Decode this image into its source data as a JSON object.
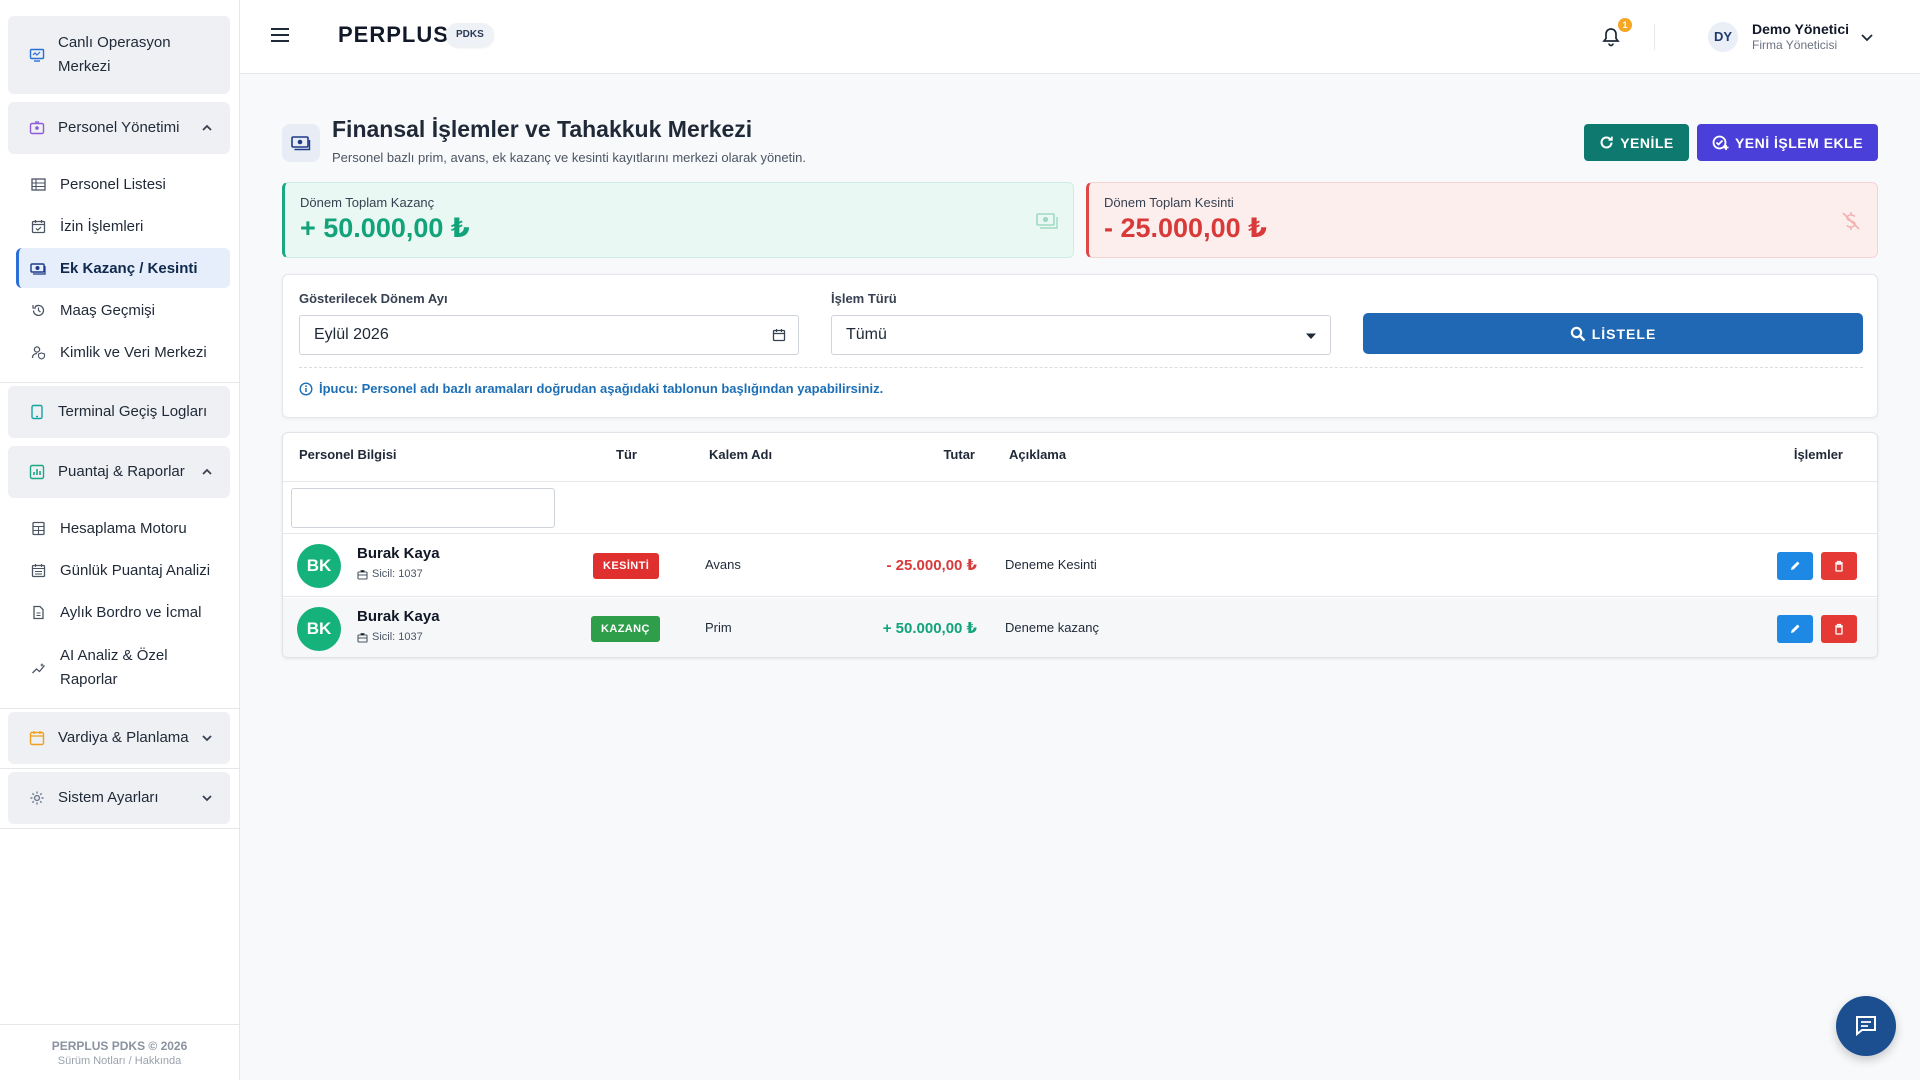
{
  "sidebar": {
    "groups": [
      {
        "label": "Canlı Operasyon Merkezi",
        "icon": "monitor-icon"
      },
      {
        "label": "Personel Yönetimi",
        "icon": "id-card-icon",
        "expanded": true
      },
      {
        "label": "Terminal Geçiş Logları",
        "icon": "tablet-icon"
      },
      {
        "label": "Puantaj & Raporlar",
        "icon": "chart-icon",
        "expanded": true
      },
      {
        "label": "Vardiya & Planlama",
        "icon": "calendar-icon",
        "expanded": false
      },
      {
        "label": "Sistem Ayarları",
        "icon": "gear-icon",
        "expanded": false
      }
    ],
    "personel_items": [
      {
        "label": "Personel Listesi",
        "icon": "table-icon"
      },
      {
        "label": "İzin İşlemleri",
        "icon": "calendar-check-icon"
      },
      {
        "label": "Ek Kazanç / Kesinti",
        "icon": "money-icon",
        "active": true
      },
      {
        "label": "Maaş Geçmişi",
        "icon": "history-icon"
      },
      {
        "label": "Kimlik ve Veri Merkezi",
        "icon": "user-shield-icon"
      }
    ],
    "puantaj_items": [
      {
        "label": "Hesaplama Motoru",
        "icon": "calculator-icon"
      },
      {
        "label": "Günlük Puantaj Analizi",
        "icon": "calendar-grid-icon"
      },
      {
        "label": "Aylık Bordro ve İcmal",
        "icon": "document-icon"
      },
      {
        "label": "AI Analiz & Özel Raporlar",
        "icon": "sparkline-icon"
      }
    ],
    "footer": {
      "copyright": "PERPLUS PDKS © 2026",
      "links": "Sürüm Notları / Hakkında"
    }
  },
  "topbar": {
    "brand": "PERPLUS",
    "brand_badge": "PDKS",
    "notification_count": "1",
    "user_initials": "DY",
    "user_name": "Demo Yönetici",
    "user_role": "Firma Yöneticisi"
  },
  "page": {
    "title": "Finansal İşlemler ve Tahakkuk Merkezi",
    "subtitle": "Personel bazlı prim, avans, ek kazanç ve kesinti kayıtlarını merkezi olarak yönetin.",
    "refresh_label": "YENİLE",
    "new_label": "YENİ İŞLEM EKLE"
  },
  "summary": {
    "earn_label": "Dönem Toplam Kazanç",
    "earn_value": "+ 50.000,00 ₺",
    "ded_label": "Dönem Toplam Kesinti",
    "ded_value": "- 25.000,00 ₺"
  },
  "filter": {
    "period_label": "Gösterilecek Dönem Ayı",
    "period_value": "Eylül 2026",
    "type_label": "İşlem Türü",
    "type_value": "Tümü",
    "list_label": "LİSTELE",
    "tip": "İpucu: Personel adı bazlı aramaları doğrudan aşağıdaki tablonun başlığından yapabilirsiniz."
  },
  "table": {
    "headers": {
      "person": "Personel Bilgisi",
      "type": "Tür",
      "item": "Kalem Adı",
      "amount": "Tutar",
      "desc": "Açıklama",
      "actions": "İşlemler"
    },
    "rows": [
      {
        "initials": "BK",
        "name": "Burak Kaya",
        "sicil": "Sicil: 1037",
        "type": "KESİNTİ",
        "item": "Avans",
        "amount": "- 25.000,00 ₺",
        "desc": "Deneme Kesinti"
      },
      {
        "initials": "BK",
        "name": "Burak Kaya",
        "sicil": "Sicil: 1037",
        "type": "KAZANÇ",
        "item": "Prim",
        "amount": "+ 50.000,00 ₺",
        "desc": "Deneme kazanç"
      }
    ]
  },
  "colors": {
    "accent": "#2168b4",
    "earn": "#12a37b",
    "deduction": "#d83a3a",
    "refresh_button": "#0e7a6f",
    "new_button": "#4b3fd9"
  }
}
